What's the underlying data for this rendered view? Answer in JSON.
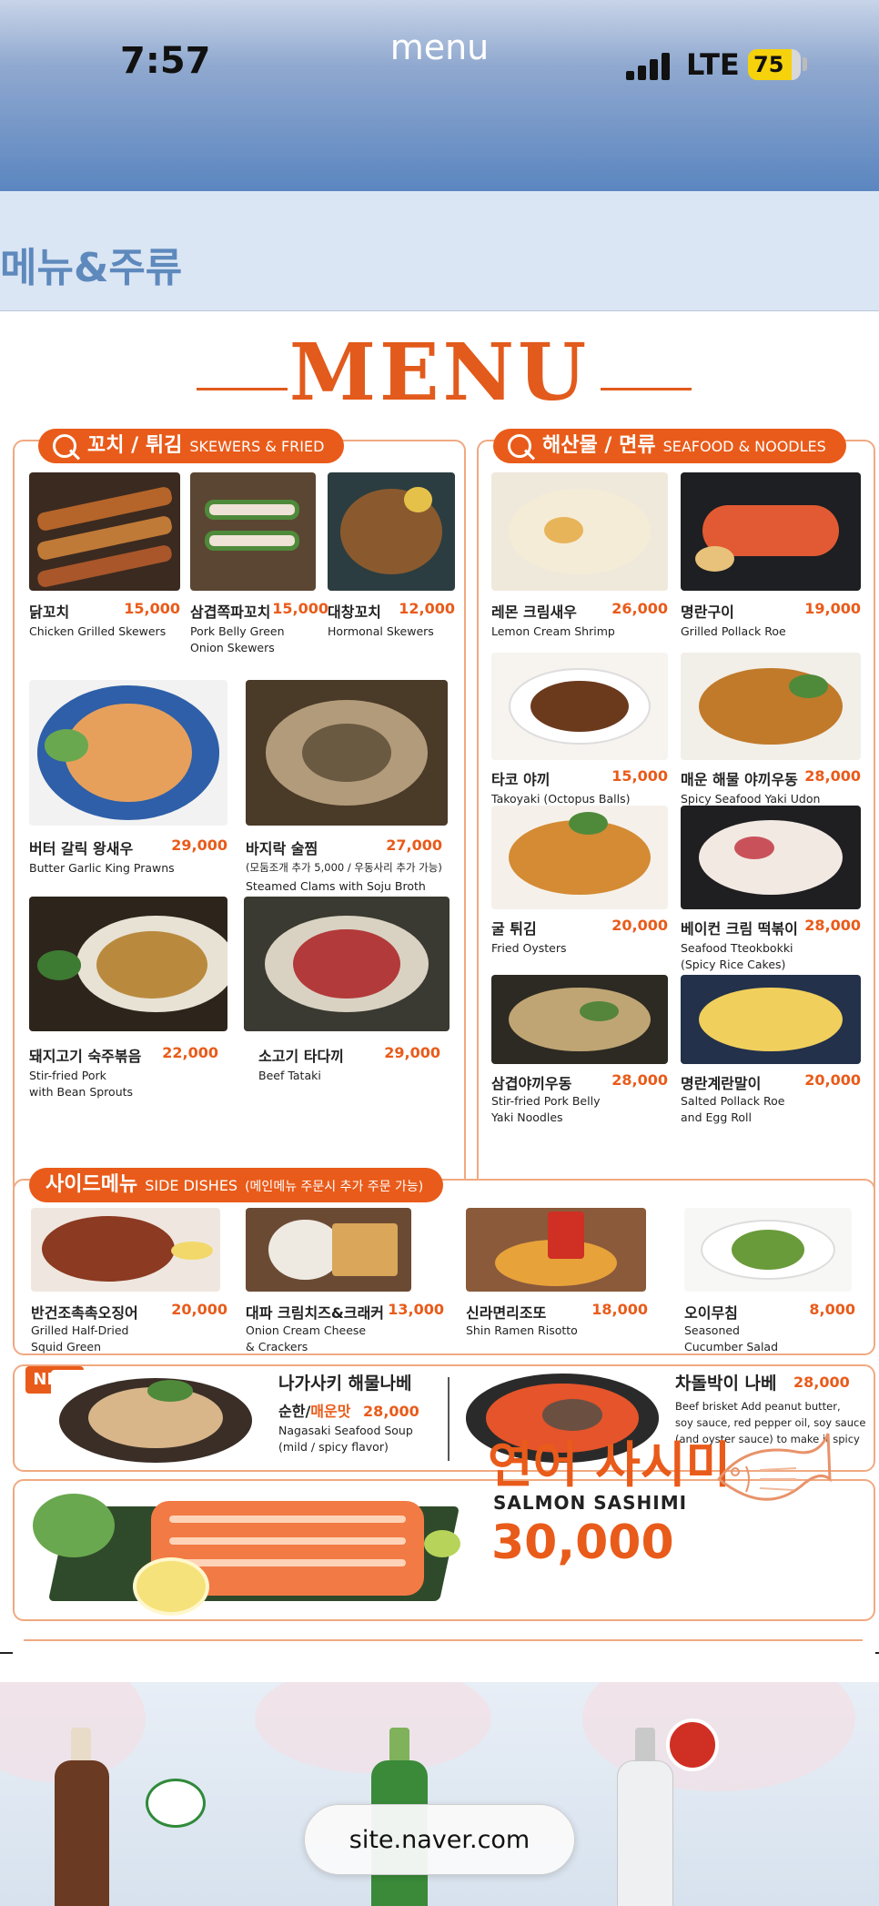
{
  "status": {
    "time": "7:57",
    "title": "menu",
    "network": "LTE",
    "battery": "75"
  },
  "page": {
    "heading": "메뉴&주류"
  },
  "board": {
    "title": "MENU",
    "skewers": {
      "tag": "꼬치 / 튀김",
      "tag_en": "SKEWERS & FRIED",
      "items": [
        {
          "ko": "닭꼬치",
          "price": "15,000",
          "en": "Chicken Grilled Skewers"
        },
        {
          "ko": "삼겹쪽파꼬치",
          "price": "15,000",
          "en": "Pork Belly Green",
          "en2": "Onion Skewers"
        },
        {
          "ko": "대창꼬치",
          "price": "12,000",
          "en": "Hormonal Skewers"
        },
        {
          "ko": "버터 갈릭 왕새우",
          "price": "29,000",
          "en": "Butter Garlic King Prawns"
        },
        {
          "ko": "바지락 술찜",
          "price": "27,000",
          "en": "(모둠조개 추가 5,000 / 우동사리 추가 가능)",
          "en2": "Steamed Clams with Soju Broth"
        },
        {
          "ko": "돼지고기 숙주볶음",
          "price": "22,000",
          "en": "Stir-fried Pork",
          "en2": "with Bean Sprouts"
        },
        {
          "ko": "소고기 타다끼",
          "price": "29,000",
          "en": "Beef Tataki"
        }
      ]
    },
    "seafood": {
      "tag": "해산물 / 면류",
      "tag_en": "SEAFOOD & NOODLES",
      "items": [
        {
          "ko": "레몬 크림새우",
          "price": "26,000",
          "en": "Lemon Cream Shrimp"
        },
        {
          "ko": "명란구이",
          "price": "19,000",
          "en": "Grilled Pollack Roe"
        },
        {
          "ko": "타코 야끼",
          "price": "15,000",
          "en": "Takoyaki (Octopus Balls)"
        },
        {
          "ko": "매운 해물 야끼우동",
          "price": "28,000",
          "en": "Spicy Seafood Yaki Udon"
        },
        {
          "ko": "굴 튀김",
          "price": "20,000",
          "en": "Fried Oysters"
        },
        {
          "ko": "베이컨 크림 떡볶이",
          "price": "28,000",
          "en": "Seafood Tteokbokki",
          "en2": "(Spicy Rice Cakes)"
        },
        {
          "ko": "삼겹야끼우동",
          "price": "28,000",
          "en": "Stir-fried Pork Belly",
          "en2": "Yaki Noodles"
        },
        {
          "ko": "명란계란말이",
          "price": "20,000",
          "en": "Salted Pollack Roe",
          "en2": "and Egg Roll"
        }
      ]
    },
    "sides": {
      "tag": "사이드메뉴",
      "tag_en": "SIDE DISHES",
      "tag_note": "(메인메뉴 주문시 추가 주문 가능)",
      "items": [
        {
          "ko": "반건조촉촉오징어",
          "price": "20,000",
          "en": "Grilled Half-Dried",
          "en2": "Squid Green"
        },
        {
          "ko": "대파 크림치즈&크래커",
          "price": "13,000",
          "en": "Onion Cream Cheese",
          "en2": "& Crackers"
        },
        {
          "ko": "신라면리조또",
          "price": "18,000",
          "en": "Shin Ramen Risotto"
        },
        {
          "ko": "오이무침",
          "price": "8,000",
          "en": "Seasoned",
          "en2": "Cucumber Salad"
        }
      ]
    },
    "new": {
      "badge": "NEW",
      "nagasaki": {
        "ko": "나가사키 해물나베",
        "sub_mild": "순한/",
        "sub_spicy": "매운맛",
        "price": "28,000",
        "en": "Nagasaki Seafood Soup",
        "en2": "(mild  /  spicy flavor)"
      },
      "brisket": {
        "ko": "차돌박이 나베",
        "price": "28,000",
        "en": "Beef brisket Add peanut butter,",
        "en2": "soy sauce, red pepper oil, soy sauce",
        "en3": "(and oyster sauce) to make it spicy"
      }
    },
    "salmon": {
      "ko": "연어 사시미",
      "en": "SALMON SASHIMI",
      "price": "30,000"
    }
  },
  "browser": {
    "url": "site.naver.com"
  },
  "colors": {
    "accent": "#e95b1a",
    "header_blue": "#5b86c0",
    "heading_blue": "#5e89bd"
  }
}
